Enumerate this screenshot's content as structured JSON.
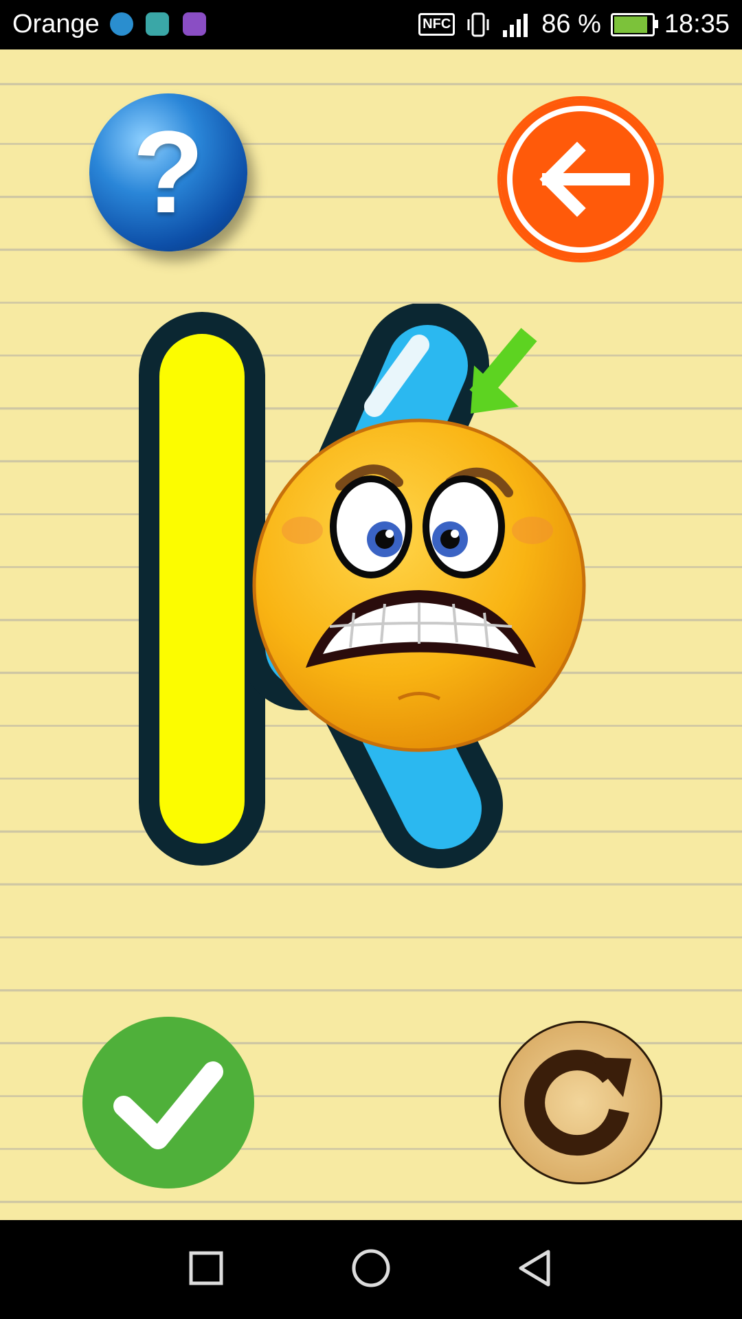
{
  "status_bar": {
    "carrier": "Orange",
    "nfc_label": "NFC",
    "battery": "86 %",
    "time": "18:35"
  },
  "letter": "K",
  "icons": {
    "help": "help-question-icon",
    "back": "back-arrow-icon",
    "check": "check-icon",
    "reload": "reload-icon",
    "hint_arrow": "hint-arrow-icon",
    "emoji": "scared-face-emoji",
    "nav_recents": "square-icon",
    "nav_home": "circle-icon",
    "nav_back": "triangle-back-icon"
  },
  "help_glyph": "?",
  "colors": {
    "paper": "#f7eaa2",
    "letter_outline": "#0b2732",
    "stroke_vertical": "#fcfc00",
    "stroke_diagonal": "#2bb8f0",
    "back_button": "#ff5a0a",
    "check_button": "#4fb03a",
    "help_button": "#1a6fd1"
  }
}
